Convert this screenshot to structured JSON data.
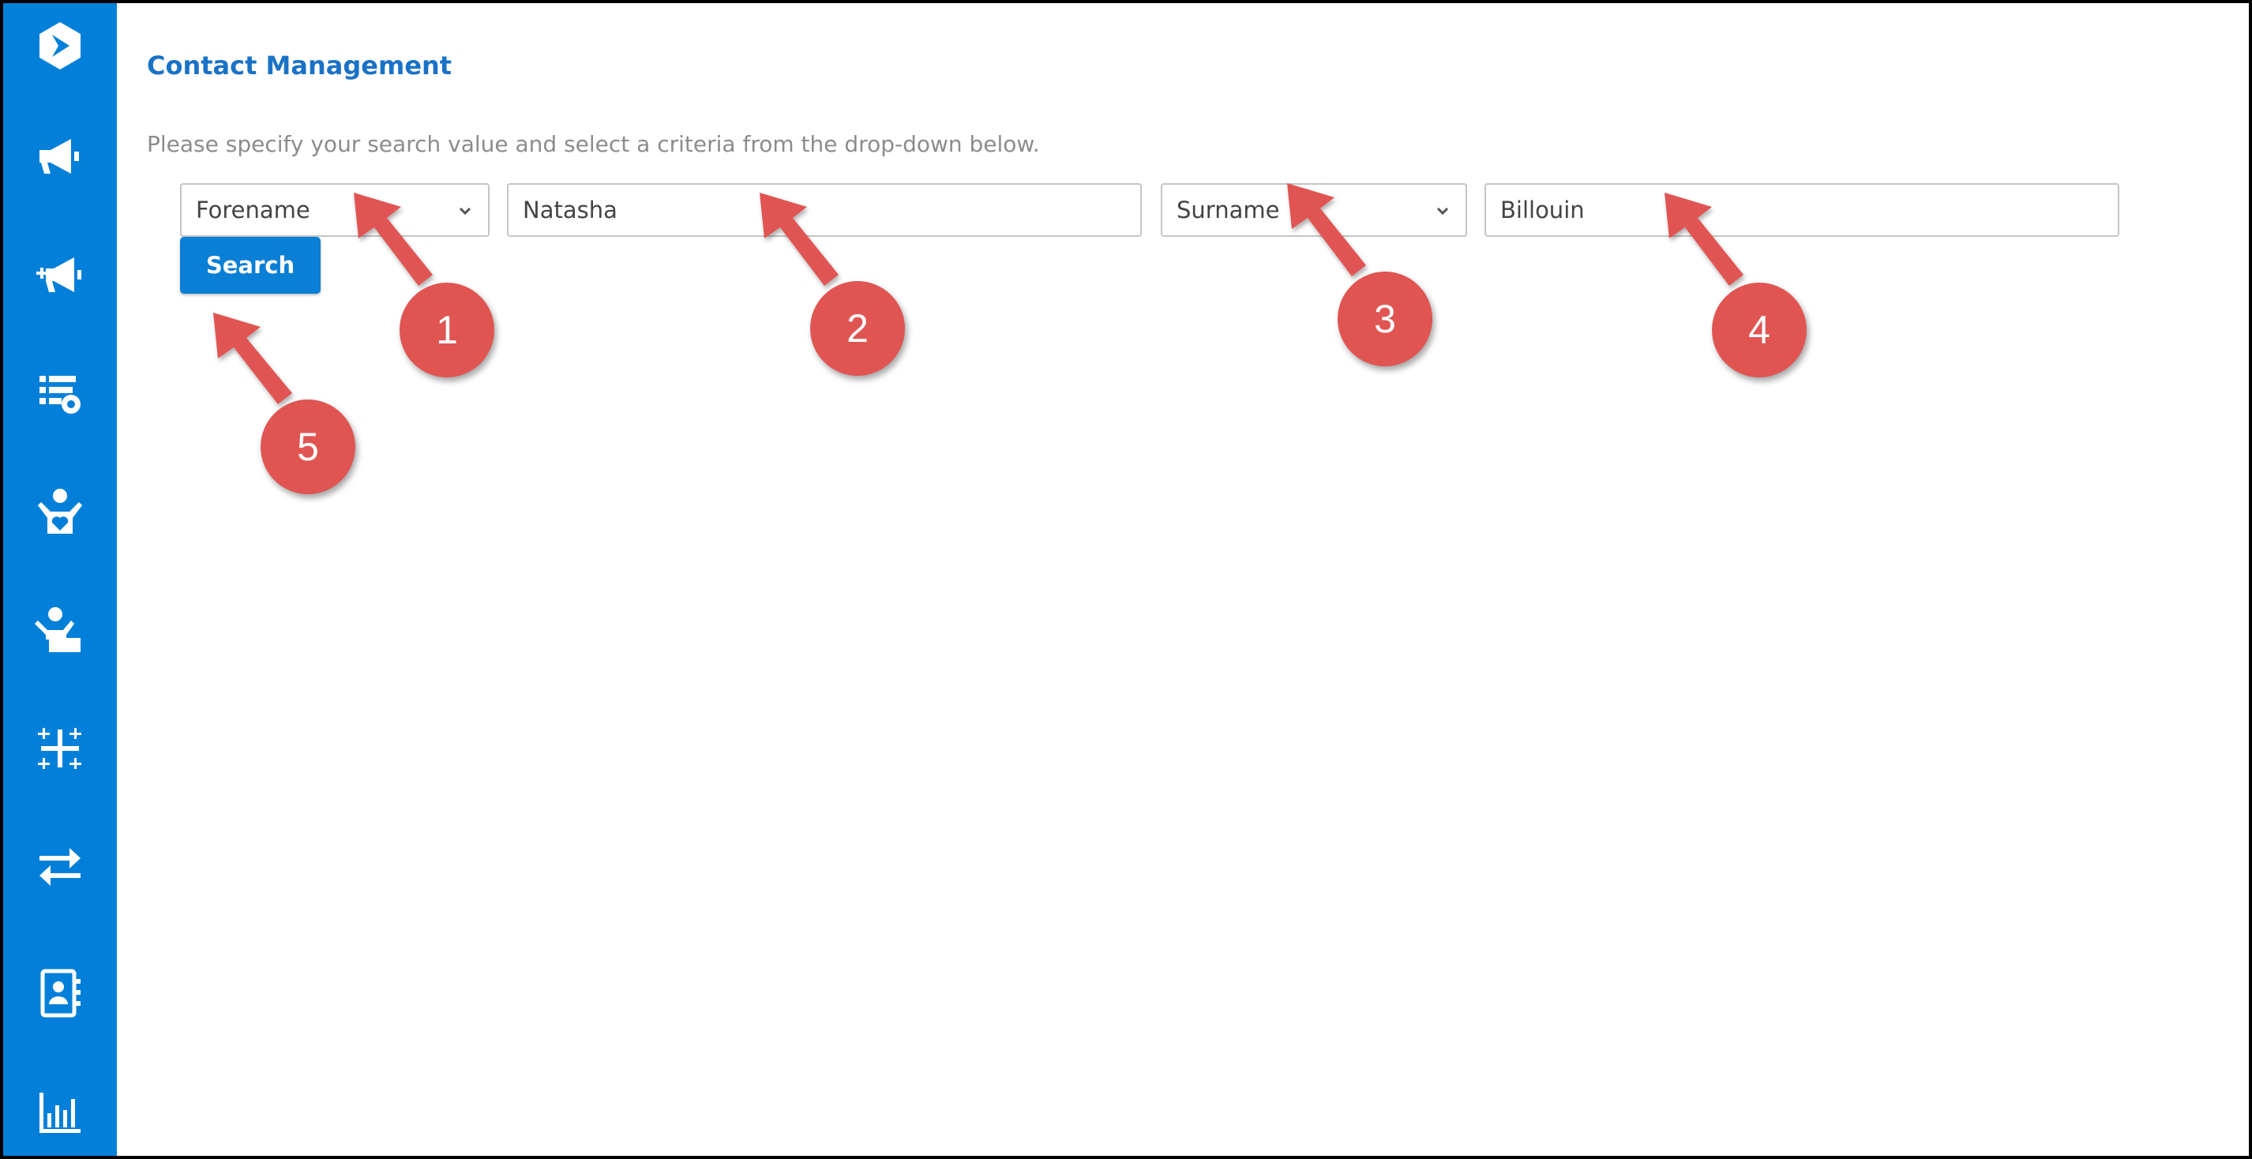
{
  "header": {
    "title": "Contact Management",
    "instruction": "Please specify your search value and select a criteria from the drop-down below."
  },
  "sidebar": {
    "items": [
      {
        "icon": "logo-icon"
      },
      {
        "icon": "megaphone-icon"
      },
      {
        "icon": "megaphone-add-icon"
      },
      {
        "icon": "list-settings-icon"
      },
      {
        "icon": "person-heart-icon"
      },
      {
        "icon": "person-card-icon"
      },
      {
        "icon": "plus-grid-icon"
      },
      {
        "icon": "transfer-icon"
      },
      {
        "icon": "contact-book-icon"
      },
      {
        "icon": "bar-chart-icon"
      }
    ]
  },
  "search": {
    "criteria1": {
      "selected": "Forename"
    },
    "value1": "Natasha",
    "criteria2": {
      "selected": "Surname"
    },
    "value2": "Billouin",
    "button_label": "Search"
  },
  "callouts": [
    "1",
    "2",
    "3",
    "4",
    "5"
  ],
  "colors": {
    "sidebar": "#0280d9",
    "accent": "#1a72c7",
    "button": "#0a7fd6",
    "callout": "#e05552"
  }
}
